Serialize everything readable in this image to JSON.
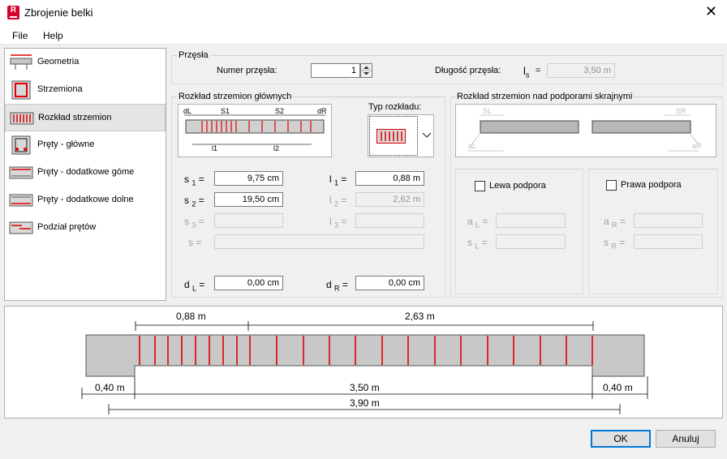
{
  "window": {
    "title": "Zbrojenie belki",
    "close_symbol": "✕",
    "logo_letter": "R"
  },
  "menu": {
    "file": "File",
    "help": "Help"
  },
  "sidebar": {
    "items": [
      {
        "label": "Geometria",
        "icon": "beam-geometry-icon"
      },
      {
        "label": "Strzemiona",
        "icon": "stirrup-icon"
      },
      {
        "label": "Rozkład strzemion",
        "icon": "stirrup-distribution-icon"
      },
      {
        "label": "Pręty - główne",
        "icon": "main-bars-icon"
      },
      {
        "label": "Pręty - dodatkowe góme",
        "icon": "top-bars-icon"
      },
      {
        "label": "Pręty - dodatkowe dolne",
        "icon": "bottom-bars-icon"
      },
      {
        "label": "Podział prętów",
        "icon": "bar-split-icon"
      }
    ],
    "selected_index": 2
  },
  "span_group": {
    "title": "Przęsła",
    "span_number_label": "Numer przęsła:",
    "span_number_value": "1",
    "span_length_label": "Długość przęsła:",
    "ls_symbol": "l",
    "ls_sub": "s",
    "eq": "=",
    "span_length_value": "3,50 m"
  },
  "main_dist": {
    "title": "Rozkład strzemion głównych",
    "dist_type_label": "Typ rozkładu:",
    "diagram": {
      "dl": "dL",
      "s1": "S1",
      "s2": "S2",
      "dr": "dR",
      "l1": "l1",
      "l2": "l2"
    },
    "s1": {
      "sym": "s",
      "sub": "1",
      "eq": "=",
      "value": "9,75 cm"
    },
    "s2": {
      "sym": "s",
      "sub": "2",
      "eq": "=",
      "value": "19,50 cm"
    },
    "s3": {
      "sym": "s",
      "sub": "3",
      "eq": "=",
      "value": ""
    },
    "s": {
      "sym": "s",
      "eq": "=",
      "value": ""
    },
    "l1": {
      "sym": "l",
      "sub": "1",
      "eq": "=",
      "value": "0,88 m"
    },
    "l2": {
      "sym": "l",
      "sub": "2",
      "eq": "=",
      "value": "2,62 m"
    },
    "l3": {
      "sym": "l",
      "sub": "3",
      "eq": "=",
      "value": ""
    },
    "dL": {
      "sym": "d",
      "sub": "L",
      "eq": "=",
      "value": "0,00 cm"
    },
    "dR": {
      "sym": "d",
      "sub": "R",
      "eq": "=",
      "value": "0,00 cm"
    }
  },
  "support_dist": {
    "title": "Rozkład strzemion nad podporami skrajnymi",
    "diagram": {
      "sl": "SL",
      "sr": "SR",
      "al": "aL",
      "ar": "aR"
    },
    "left": {
      "label": "Lewa podpora",
      "a_sym": "a",
      "a_sub": "L",
      "s_sym": "s",
      "s_sub": "L",
      "eq": "="
    },
    "right": {
      "label": "Prawa podpora",
      "a_sym": "a",
      "a_sub": "R",
      "s_sym": "s",
      "s_sub": "R",
      "eq": "="
    }
  },
  "preview": {
    "dims": {
      "l1": "0,88 m",
      "l2": "2,63 m",
      "left_support": "0,40 m",
      "clear_span": "3,50 m",
      "right_support": "0,40 m",
      "total": "3,90 m"
    },
    "stirrup_color": "#e00000",
    "beam_color": "#c8c8c8"
  },
  "buttons": {
    "ok": "OK",
    "cancel": "Anuluj"
  }
}
